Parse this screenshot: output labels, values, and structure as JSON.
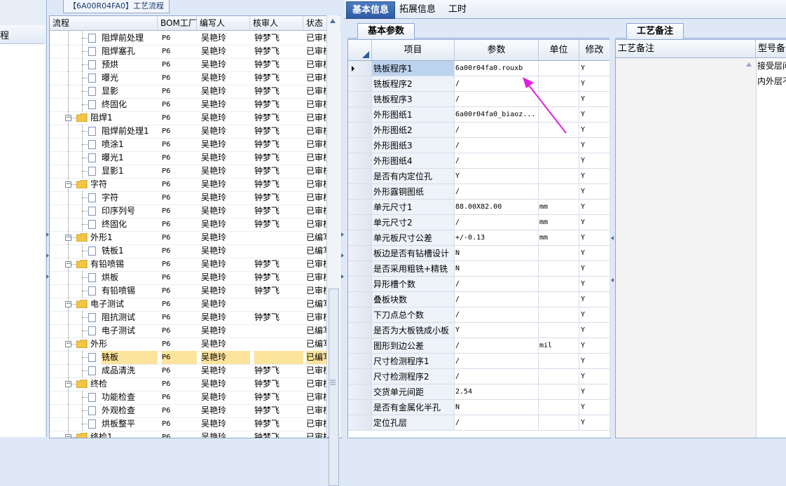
{
  "left_panel": {
    "label": "程"
  },
  "process_panel": {
    "title": "【6A00R04FA0】工艺流程",
    "headers": [
      "流程",
      "BOM工厂",
      "编写人",
      "核审人",
      "状态"
    ],
    "rows": [
      {
        "indent": 2,
        "type": "doc",
        "name": "阻焊前处理",
        "bom": "P6",
        "writer": "吴艳玲",
        "reviewer": "钟梦飞",
        "status": "已审核"
      },
      {
        "indent": 2,
        "type": "doc",
        "name": "阻焊塞孔",
        "bom": "P6",
        "writer": "吴艳玲",
        "reviewer": "钟梦飞",
        "status": "已审核"
      },
      {
        "indent": 2,
        "type": "doc",
        "name": "预烘",
        "bom": "P6",
        "writer": "吴艳玲",
        "reviewer": "钟梦飞",
        "status": "已审核"
      },
      {
        "indent": 2,
        "type": "doc",
        "name": "曝光",
        "bom": "P6",
        "writer": "吴艳玲",
        "reviewer": "钟梦飞",
        "status": "已审核"
      },
      {
        "indent": 2,
        "type": "doc",
        "name": "显影",
        "bom": "P6",
        "writer": "吴艳玲",
        "reviewer": "钟梦飞",
        "status": "已审核"
      },
      {
        "indent": 2,
        "type": "doc",
        "name": "终固化",
        "bom": "P6",
        "writer": "吴艳玲",
        "reviewer": "钟梦飞",
        "status": "已审核"
      },
      {
        "indent": 1,
        "type": "folder",
        "name": "阻焊1",
        "bom": "P6",
        "writer": "吴艳玲",
        "reviewer": "钟梦飞",
        "status": "已审核"
      },
      {
        "indent": 2,
        "type": "doc",
        "name": "阻焊前处理1",
        "bom": "P6",
        "writer": "吴艳玲",
        "reviewer": "钟梦飞",
        "status": "已审核"
      },
      {
        "indent": 2,
        "type": "doc",
        "name": "喷涂1",
        "bom": "P6",
        "writer": "吴艳玲",
        "reviewer": "钟梦飞",
        "status": "已审核"
      },
      {
        "indent": 2,
        "type": "doc",
        "name": "曝光1",
        "bom": "P6",
        "writer": "吴艳玲",
        "reviewer": "钟梦飞",
        "status": "已审核"
      },
      {
        "indent": 2,
        "type": "doc",
        "name": "显影1",
        "bom": "P6",
        "writer": "吴艳玲",
        "reviewer": "钟梦飞",
        "status": "已审核"
      },
      {
        "indent": 1,
        "type": "folder",
        "name": "字符",
        "bom": "P6",
        "writer": "吴艳玲",
        "reviewer": "钟梦飞",
        "status": "已审核"
      },
      {
        "indent": 2,
        "type": "doc",
        "name": "字符",
        "bom": "P6",
        "writer": "吴艳玲",
        "reviewer": "钟梦飞",
        "status": "已审核"
      },
      {
        "indent": 2,
        "type": "doc",
        "name": "印序列号",
        "bom": "P6",
        "writer": "吴艳玲",
        "reviewer": "钟梦飞",
        "status": "已审核"
      },
      {
        "indent": 2,
        "type": "doc",
        "name": "终固化",
        "bom": "P6",
        "writer": "吴艳玲",
        "reviewer": "钟梦飞",
        "status": "已审核"
      },
      {
        "indent": 1,
        "type": "folder",
        "name": "外形1",
        "bom": "P6",
        "writer": "吴艳玲",
        "reviewer": "",
        "status": "已编写"
      },
      {
        "indent": 2,
        "type": "doc",
        "name": "铣板1",
        "bom": "P6",
        "writer": "吴艳玲",
        "reviewer": "",
        "status": "已编写"
      },
      {
        "indent": 1,
        "type": "folder",
        "name": "有铅喷锡",
        "bom": "P6",
        "writer": "吴艳玲",
        "reviewer": "钟梦飞",
        "status": "已审核"
      },
      {
        "indent": 2,
        "type": "doc",
        "name": "烘板",
        "bom": "P6",
        "writer": "吴艳玲",
        "reviewer": "钟梦飞",
        "status": "已审核"
      },
      {
        "indent": 2,
        "type": "doc",
        "name": "有铅喷锡",
        "bom": "P6",
        "writer": "吴艳玲",
        "reviewer": "钟梦飞",
        "status": "已审核"
      },
      {
        "indent": 1,
        "type": "folder",
        "name": "电子测试",
        "bom": "P6",
        "writer": "吴艳玲",
        "reviewer": "",
        "status": "已编写"
      },
      {
        "indent": 2,
        "type": "doc",
        "name": "阻抗测试",
        "bom": "P6",
        "writer": "吴艳玲",
        "reviewer": "钟梦飞",
        "status": "已审核"
      },
      {
        "indent": 2,
        "type": "doc",
        "name": "电子测试",
        "bom": "P6",
        "writer": "吴艳玲",
        "reviewer": "",
        "status": "已编写"
      },
      {
        "indent": 1,
        "type": "folder",
        "name": "外形",
        "bom": "P6",
        "writer": "吴艳玲",
        "reviewer": "",
        "status": "已编写"
      },
      {
        "indent": 2,
        "type": "doc",
        "name": "铣板",
        "bom": "P6",
        "writer": "吴艳玲",
        "reviewer": "",
        "status": "已编写",
        "selected": true
      },
      {
        "indent": 2,
        "type": "doc",
        "name": "成品清洗",
        "bom": "P6",
        "writer": "吴艳玲",
        "reviewer": "钟梦飞",
        "status": "已审核"
      },
      {
        "indent": 1,
        "type": "folder",
        "name": "终检",
        "bom": "P6",
        "writer": "吴艳玲",
        "reviewer": "钟梦飞",
        "status": "已审核"
      },
      {
        "indent": 2,
        "type": "doc",
        "name": "功能检查",
        "bom": "P6",
        "writer": "吴艳玲",
        "reviewer": "钟梦飞",
        "status": "已审核"
      },
      {
        "indent": 2,
        "type": "doc",
        "name": "外观检查",
        "bom": "P6",
        "writer": "吴艳玲",
        "reviewer": "钟梦飞",
        "status": "已审核"
      },
      {
        "indent": 2,
        "type": "doc",
        "name": "烘板整平",
        "bom": "P6",
        "writer": "吴艳玲",
        "reviewer": "钟梦飞",
        "status": "已审核"
      },
      {
        "indent": 1,
        "type": "folder",
        "name": "终检1",
        "bom": "P6",
        "writer": "吴艳玲",
        "reviewer": "钟梦飞",
        "status": "已审核"
      }
    ]
  },
  "tabs": [
    "基本信息",
    "拓展信息",
    "工时"
  ],
  "active_tab": 0,
  "basic_params": {
    "tab_label": "基本参数",
    "headers": [
      "项目",
      "参数",
      "单位",
      "修改"
    ],
    "rows": [
      {
        "name": "铣板程序1",
        "value": "6a00r04fa0.rouxb",
        "unit": "",
        "mod": "Y",
        "current": true
      },
      {
        "name": "铣板程序2",
        "value": "/",
        "unit": "",
        "mod": "Y"
      },
      {
        "name": "铣板程序3",
        "value": "/",
        "unit": "",
        "mod": "Y"
      },
      {
        "name": "外形图纸1",
        "value": "6a00r04fa0_biaoz...",
        "unit": "",
        "mod": "Y"
      },
      {
        "name": "外形图纸2",
        "value": "/",
        "unit": "",
        "mod": "Y"
      },
      {
        "name": "外形图纸3",
        "value": "/",
        "unit": "",
        "mod": "Y"
      },
      {
        "name": "外形图纸4",
        "value": "/",
        "unit": "",
        "mod": "Y"
      },
      {
        "name": "是否有内定位孔",
        "value": "Y",
        "unit": "",
        "mod": "Y"
      },
      {
        "name": "外形露铜图纸",
        "value": "/",
        "unit": "",
        "mod": "Y"
      },
      {
        "name": "单元尺寸1",
        "value": "88.00X82.00",
        "unit": "mm",
        "mod": "Y"
      },
      {
        "name": "单元尺寸2",
        "value": "/",
        "unit": "mm",
        "mod": "Y"
      },
      {
        "name": "单元板尺寸公差",
        "value": "+/-0.13",
        "unit": "mm",
        "mod": "Y"
      },
      {
        "name": "板边是否有钻槽设计",
        "value": "N",
        "unit": "",
        "mod": "Y"
      },
      {
        "name": "是否采用粗铣+精铣",
        "value": "N",
        "unit": "",
        "mod": "Y"
      },
      {
        "name": "异形槽个数",
        "value": "/",
        "unit": "",
        "mod": "Y"
      },
      {
        "name": "叠板块数",
        "value": "/",
        "unit": "",
        "mod": "Y"
      },
      {
        "name": "下刀点总个数",
        "value": "/",
        "unit": "",
        "mod": "Y"
      },
      {
        "name": "是否为大板铣成小板",
        "value": "Y",
        "unit": "",
        "mod": "Y"
      },
      {
        "name": "图形到边公差",
        "value": "/",
        "unit": "mil",
        "mod": "Y"
      },
      {
        "name": "尺寸检测程序1",
        "value": "/",
        "unit": "",
        "mod": "Y"
      },
      {
        "name": "尺寸检测程序2",
        "value": "/",
        "unit": "",
        "mod": "Y"
      },
      {
        "name": "交货单元间距",
        "value": "2.54",
        "unit": "",
        "mod": "Y"
      },
      {
        "name": "是否有金属化半孔",
        "value": "N",
        "unit": "",
        "mod": "Y"
      },
      {
        "name": "定位孔层",
        "value": "/",
        "unit": "",
        "mod": "Y"
      }
    ]
  },
  "process_notes": {
    "tab_label": "工艺备注",
    "headers": [
      "工艺备注",
      "型号备注"
    ],
    "model_notes": [
      "接受层间",
      "内外层不"
    ]
  },
  "colors": {
    "active_tab_bg": "#2d5ba6",
    "selected_row": "#fde49c",
    "annotation_arrow": "#e020e0",
    "folder": "#f5c542"
  }
}
